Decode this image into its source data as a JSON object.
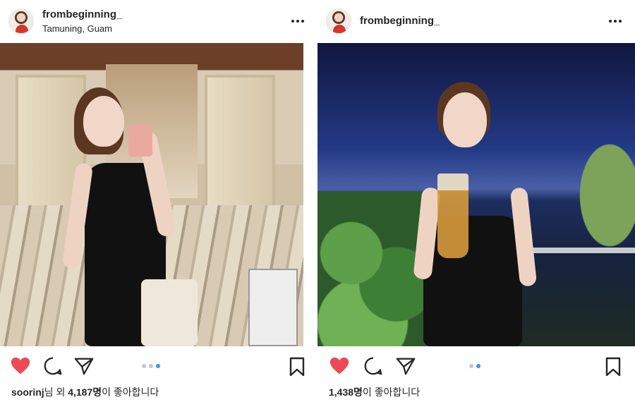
{
  "posts": [
    {
      "username": "frombeginning_",
      "location": "Tamuning, Guam",
      "likes": {
        "user": "soorinj",
        "mid": "님 외 ",
        "count": "4,187명",
        "suffix": "이 좋아합니다"
      },
      "carousel": {
        "total": 3,
        "active_index": 2
      },
      "photo": "elevator-lobby-selfie"
    },
    {
      "username": "frombeginning_",
      "location": "",
      "likes": {
        "user": "",
        "mid": "",
        "count": "1,438명",
        "suffix": "이 좋아합니다"
      },
      "carousel": {
        "total": 2,
        "active_index": 1
      },
      "photo": "night-sea-drink"
    }
  ],
  "icons": {
    "more": "more-horizontal-icon",
    "heart": "heart-filled-icon",
    "comment": "comment-icon",
    "share": "share-icon",
    "save": "bookmark-icon"
  },
  "colors": {
    "heart": "#ed4956",
    "carousel_active": "#3897f0",
    "carousel_inactive": "#c7c7c7",
    "text": "#262626"
  }
}
